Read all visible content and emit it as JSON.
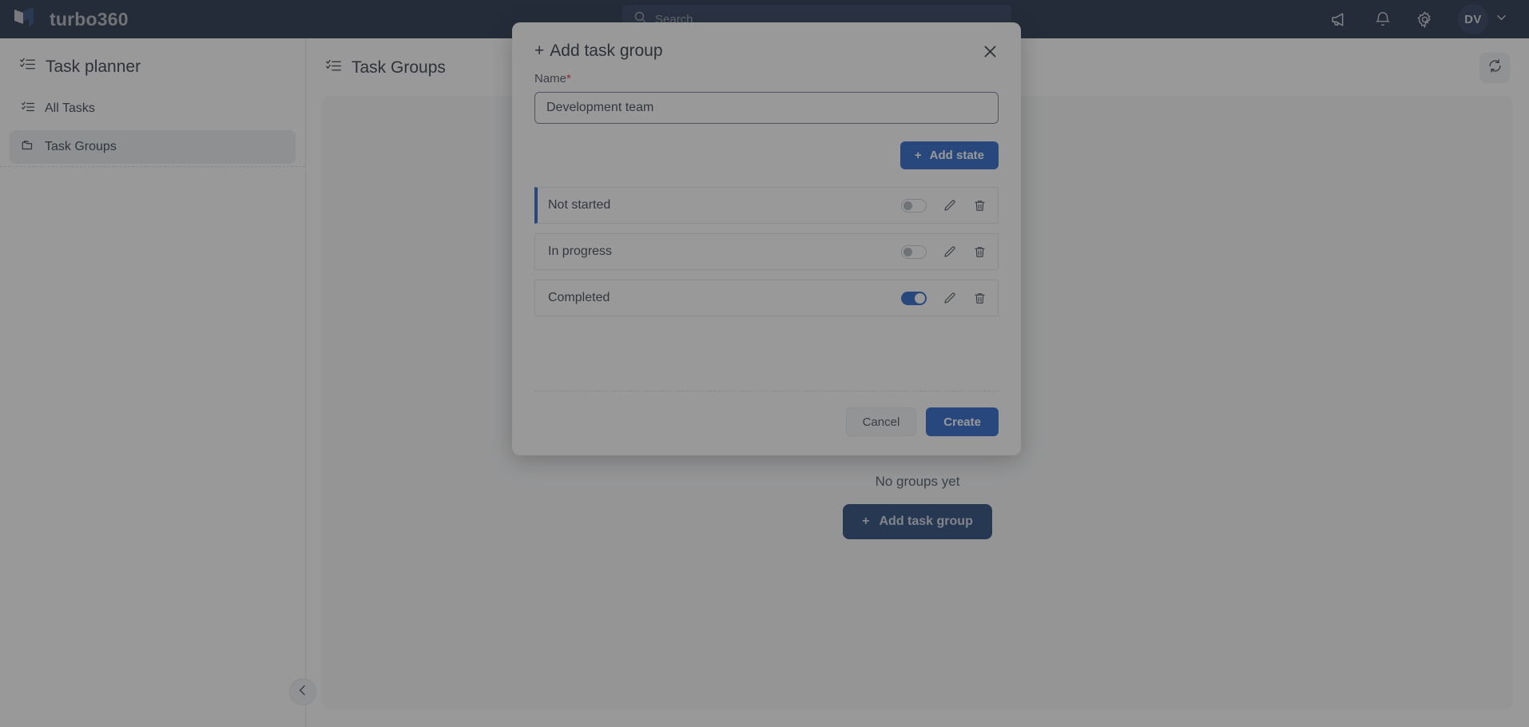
{
  "topbar": {
    "brand_name": "turbo360",
    "logo_icon": "turbo360-logo",
    "search": {
      "placeholder": "Search",
      "value": "",
      "icon": "search-icon"
    },
    "actions": [
      {
        "icon": "megaphone-icon",
        "name": "announcements-button"
      },
      {
        "icon": "bell-icon",
        "name": "notifications-button"
      },
      {
        "icon": "gear-icon",
        "name": "settings-button"
      }
    ],
    "user": {
      "initials": "DV",
      "chevron_icon": "chevron-down-icon"
    },
    "background_color": "#0b1c38"
  },
  "sidebar": {
    "title": "Task planner",
    "title_icon": "checklist-icon",
    "items": [
      {
        "label": "All Tasks",
        "icon": "checklist-icon",
        "active": false
      },
      {
        "label": "Task Groups",
        "icon": "folder-icon",
        "active": true
      }
    ],
    "collapse_icon": "chevron-left-icon"
  },
  "main": {
    "title": "Task Groups",
    "title_icon": "checklist-icon",
    "refresh_icon": "refresh-icon",
    "empty_state": {
      "text": "No groups yet",
      "button_label": "Add task group",
      "button_icon": "plus-icon",
      "button_color": "#11366d",
      "illustration": "empty-documents-illustration"
    }
  },
  "modal": {
    "title": "Add task group",
    "title_icon": "plus-icon",
    "close_icon": "close-icon",
    "name_field": {
      "label": "Name",
      "required_marker": "*",
      "value": "Development team",
      "placeholder": ""
    },
    "add_state_button": {
      "label": "Add state",
      "icon": "plus-icon",
      "color": "#1357c4"
    },
    "states": [
      {
        "name": "Not started",
        "enabled": false,
        "accent": true,
        "accent_color": "#1357c4",
        "edit_icon": "pencil-icon",
        "delete_icon": "trash-icon"
      },
      {
        "name": "In progress",
        "enabled": false,
        "accent": false,
        "accent_color": "",
        "edit_icon": "pencil-icon",
        "delete_icon": "trash-icon"
      },
      {
        "name": "Completed",
        "enabled": true,
        "accent": false,
        "accent_color": "",
        "edit_icon": "pencil-icon",
        "delete_icon": "trash-icon"
      }
    ],
    "footer": {
      "cancel_label": "Cancel",
      "create_label": "Create",
      "create_color": "#1357c4"
    }
  }
}
